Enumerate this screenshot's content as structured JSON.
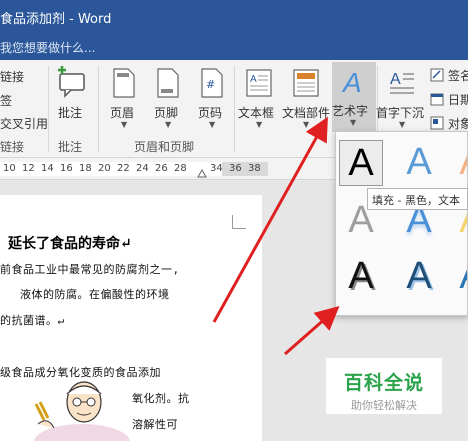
{
  "window": {
    "title": "食品添加剂 - Word"
  },
  "tell_me": {
    "placeholder": "我您想要做什么..."
  },
  "ribbon": {
    "links_group": {
      "items": [
        "链接",
        "签",
        "交叉引用"
      ],
      "label": "链接"
    },
    "comment_group": {
      "button": "批注",
      "label": "批注"
    },
    "header_footer_group": {
      "buttons": [
        "页眉",
        "页脚",
        "页码"
      ],
      "label": "页眉和页脚"
    },
    "text_group": {
      "buttons": [
        "文本框",
        "文档部件",
        "艺术字",
        "首字下沉"
      ],
      "side_items": [
        "签名",
        "日期",
        "对象"
      ]
    }
  },
  "ruler": {
    "ticks": [
      "10",
      "12",
      "14",
      "16",
      "18",
      "20",
      "22",
      "24",
      "26",
      "28",
      "34",
      "36",
      "38"
    ]
  },
  "document": {
    "heading": "延长了食品的寿命↵",
    "lines": [
      "前食品工业中最常见的防腐剂之一,",
      "液体的防腐。在偏酸性的环境",
      "的抗菌谱。↵",
      "级食品成分氧化变质的食品添加",
      "氧化剂。抗",
      "溶解性可"
    ]
  },
  "wordart_gallery": {
    "sample_letter": "A",
    "tooltip": "填充 - 黑色，文本"
  },
  "watermark": {
    "main": "百科全说",
    "sub": "助你轻松解决"
  },
  "colors": {
    "title_blue": "#2b579a",
    "arrow_red": "#e02020",
    "wordart_blue": "#4a90d9",
    "watermark_green": "#2aa34a"
  }
}
